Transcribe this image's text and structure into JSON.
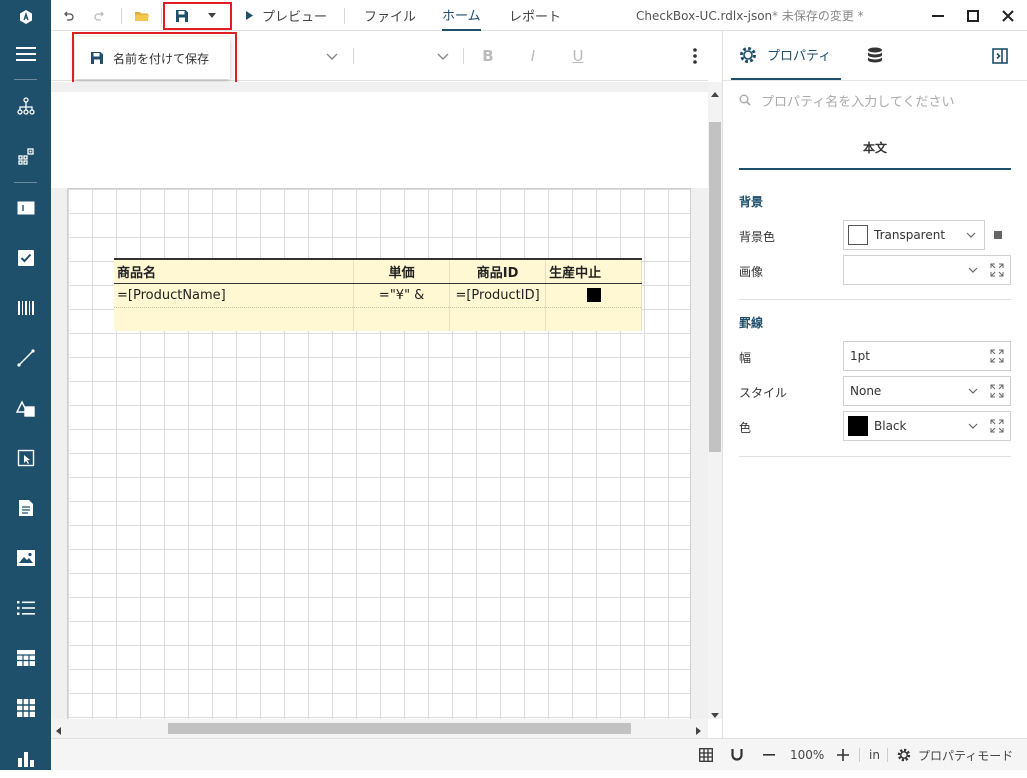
{
  "titlebar": {
    "preview_label": "プレビュー",
    "tabs": [
      {
        "label": "ファイル"
      },
      {
        "label": "ホーム"
      },
      {
        "label": "レポート"
      }
    ],
    "filename": "CheckBox-UC.rdlx-json",
    "unsaved": "* 未保存の変更 *"
  },
  "save_menu": {
    "save_as_label": "名前を付けて保存"
  },
  "report": {
    "headers": [
      "商品名",
      "単価",
      "商品ID",
      "生産中止"
    ],
    "row": [
      "=[ProductName]",
      "=\"¥\" &",
      "=[ProductID]",
      ""
    ]
  },
  "panel": {
    "tab_properties": "プロパティ",
    "search_placeholder": "プロパティ名を入力してください",
    "subtitle": "本文",
    "background_section": "背景",
    "bg_color_label": "背景色",
    "bg_color_value": "Transparent",
    "image_label": "画像",
    "image_value": "",
    "border_section": "罫線",
    "width_label": "幅",
    "width_value": "1pt",
    "style_label": "スタイル",
    "style_value": "None",
    "color_label": "色",
    "color_value": "Black"
  },
  "status": {
    "zoom": "100%",
    "unit": "in",
    "mode": "プロパティモード"
  },
  "colors": {
    "sidebar": "#1e4f6b",
    "accent": "#1e4f6b",
    "highlight": "#e02020",
    "table_fill": "#fff8d2"
  }
}
